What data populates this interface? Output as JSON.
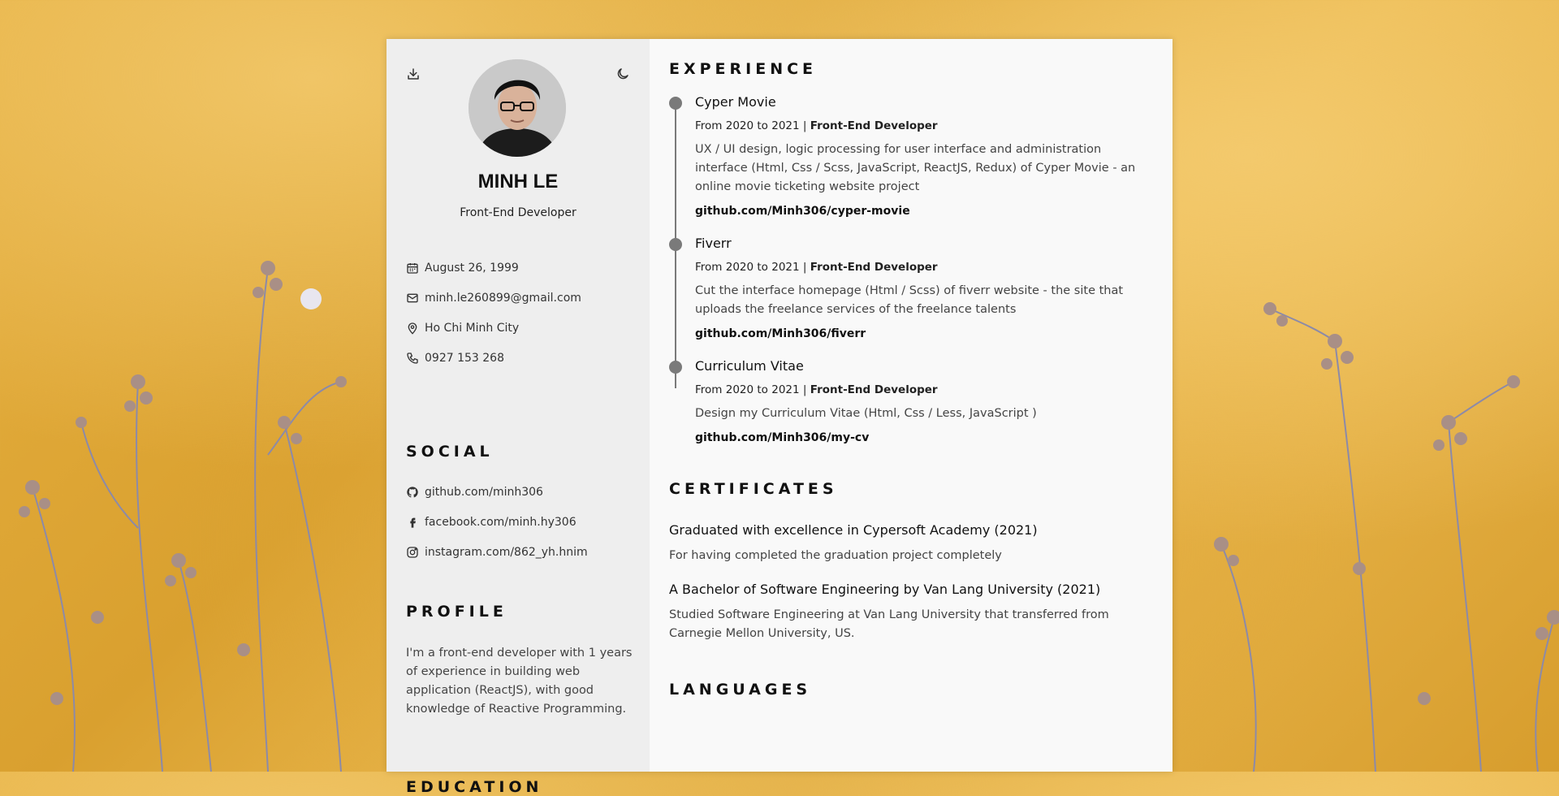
{
  "header": {
    "name": "MINH LE",
    "role": "Front-End Developer",
    "download_icon": "download-icon",
    "theme_icon": "moon-icon"
  },
  "contact": [
    {
      "icon": "calendar-icon",
      "text": "August 26, 1999"
    },
    {
      "icon": "mail-icon",
      "text": "minh.le260899@gmail.com"
    },
    {
      "icon": "map-pin-icon",
      "text": "Ho Chi Minh City"
    },
    {
      "icon": "phone-icon",
      "text": "0927 153 268"
    }
  ],
  "social": {
    "title": "SOCIAL",
    "items": [
      {
        "icon": "github-icon",
        "text": "github.com/minh306"
      },
      {
        "icon": "facebook-icon",
        "text": "facebook.com/minh.hy306"
      },
      {
        "icon": "instagram-icon",
        "text": "instagram.com/862_yh.hnim"
      }
    ]
  },
  "profile": {
    "title": "PROFILE",
    "text": "I'm a front-end developer with 1 years of experience in building web application (ReactJS), with good knowledge of Reactive Programming."
  },
  "education": {
    "title": "EDUCATION"
  },
  "experience": {
    "title": "EXPERIENCE",
    "items": [
      {
        "title": "Cyper Movie",
        "period": "From 2020 to 2021 | ",
        "position": "Front-End Developer",
        "desc": "UX / UI design, logic processing for user interface and administration interface (Html, Css / Scss, JavaScript, ReactJS, Redux) of Cyper Movie - an online movie ticketing website project",
        "link": "github.com/Minh306/cyper-movie"
      },
      {
        "title": "Fiverr",
        "period": "From 2020 to 2021 | ",
        "position": "Front-End Developer",
        "desc": "Cut the interface homepage (Html / Scss) of fiverr website - the site that uploads the freelance services of the freelance talents",
        "link": "github.com/Minh306/fiverr"
      },
      {
        "title": "Curriculum Vitae",
        "period": "From 2020 to 2021 | ",
        "position": "Front-End Developer",
        "desc": "Design my Curriculum Vitae (Html, Css / Less, JavaScript )",
        "link": "github.com/Minh306/my-cv"
      }
    ]
  },
  "certificates": {
    "title": "CERTIFICATES",
    "items": [
      {
        "title": "Graduated with excellence in Cypersoft Academy (2021)",
        "desc": "For having completed the graduation project completely"
      },
      {
        "title": "A Bachelor of Software Engineering by Van Lang University (2021)",
        "desc": "Studied Software Engineering at Van Lang University that transferred from Carnegie Mellon University, US."
      }
    ]
  },
  "languages": {
    "title": "LANGUAGES"
  },
  "colors": {
    "sidebar": "#eeeeee",
    "main": "#f9f9f9",
    "timeline": "#7a7a7a",
    "background": "#e0a83a"
  }
}
